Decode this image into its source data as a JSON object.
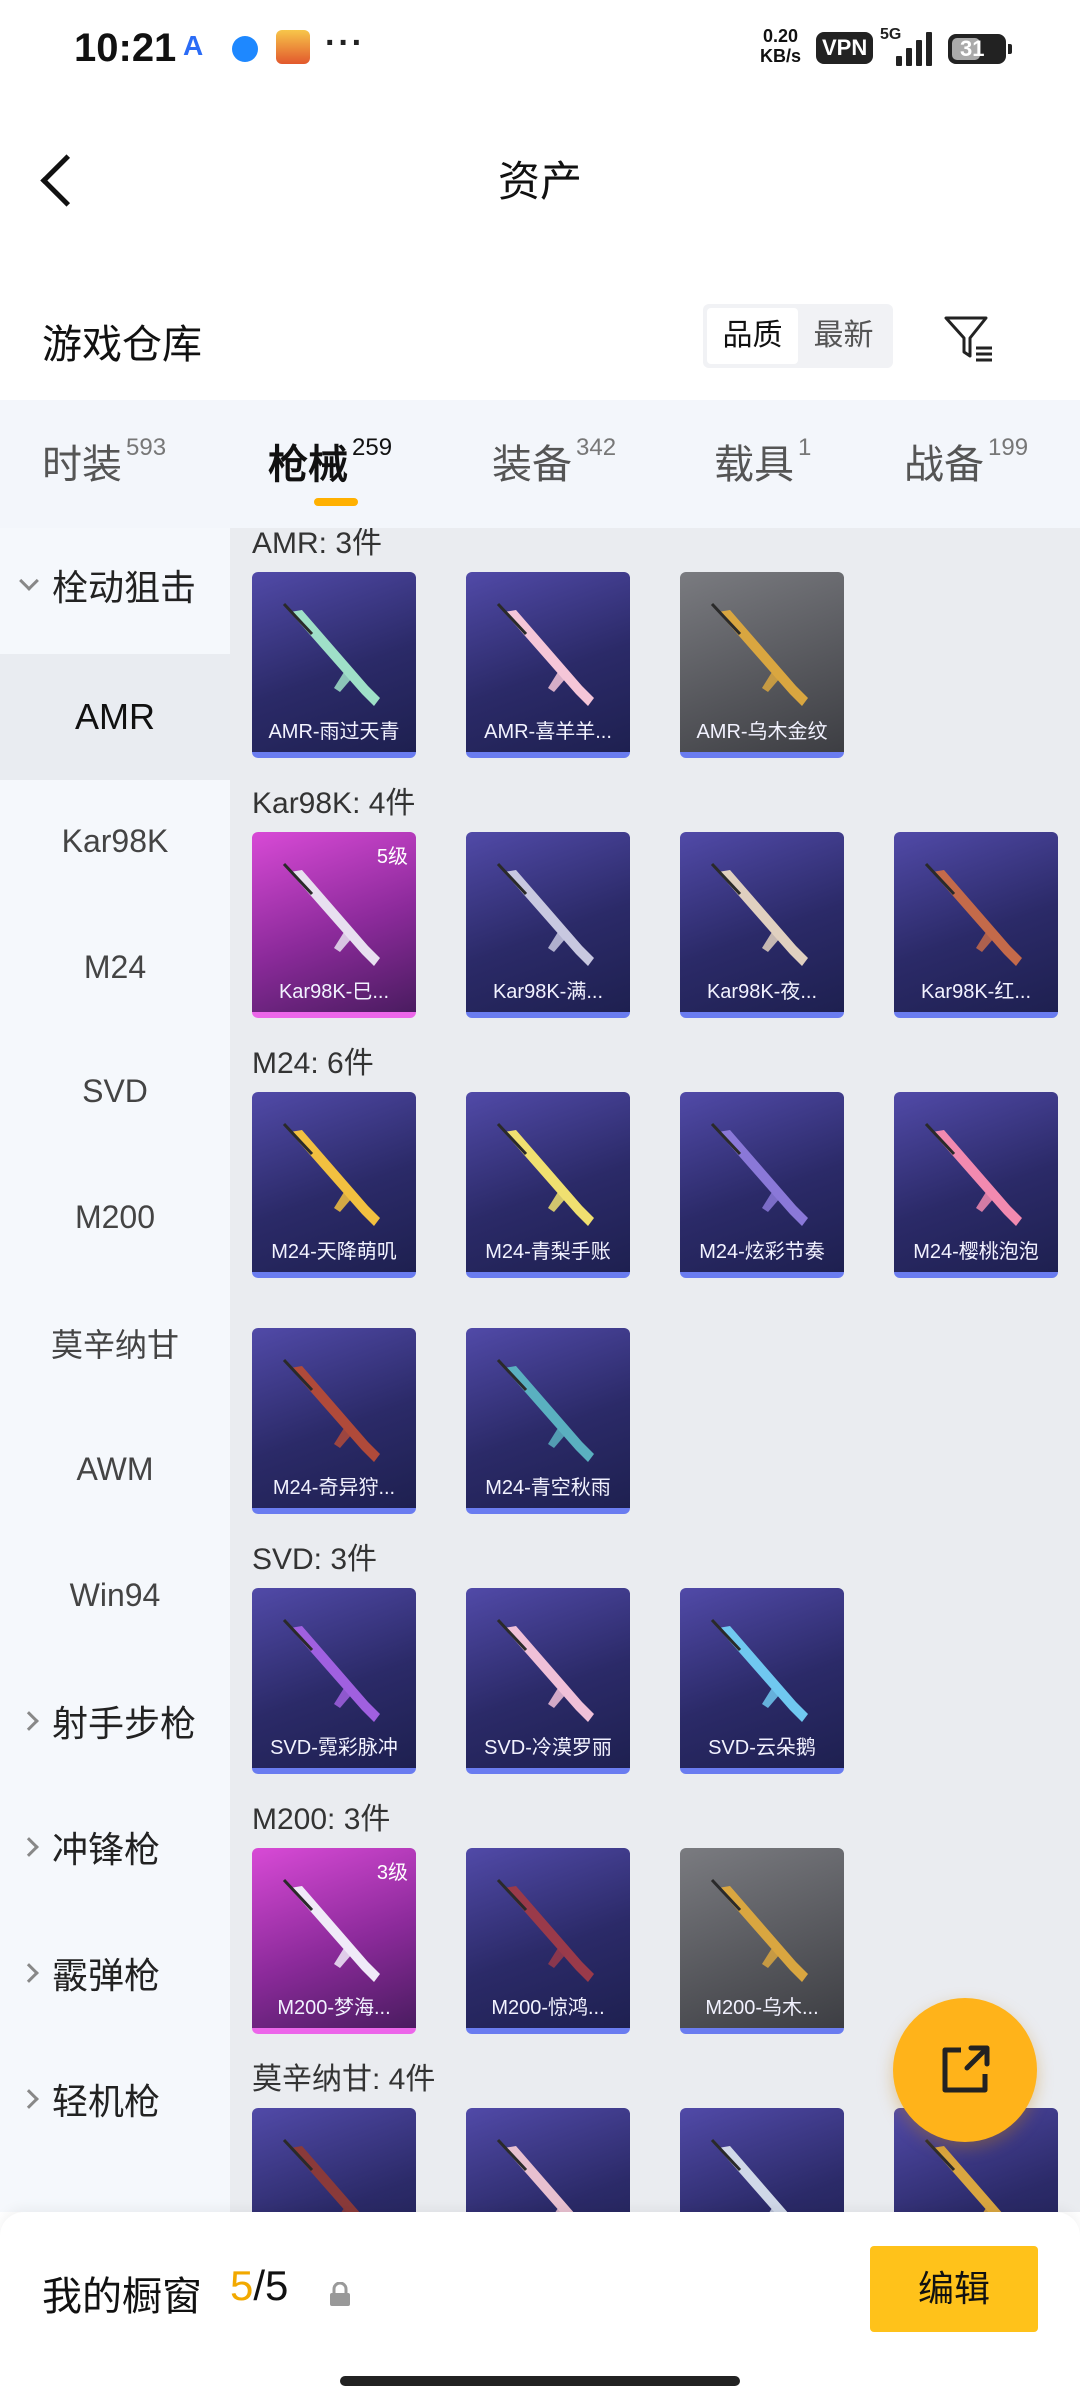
{
  "status_bar": {
    "time": "10:21",
    "net_speed_value": "0.20",
    "net_speed_unit": "KB/s",
    "vpn": "VPN",
    "network": "5G",
    "battery": "31"
  },
  "header": {
    "title": "资产"
  },
  "section": {
    "title": "游戏仓库",
    "sort_options": [
      "品质",
      "最新"
    ],
    "sort_active": "品质"
  },
  "category_tabs": [
    {
      "label": "时装",
      "count": "593"
    },
    {
      "label": "枪械",
      "count": "259",
      "active": true
    },
    {
      "label": "装备",
      "count": "342"
    },
    {
      "label": "载具",
      "count": "1"
    },
    {
      "label": "战备",
      "count": "199"
    }
  ],
  "sidebar": [
    {
      "label": "栓动狙击",
      "type": "group",
      "expanded": true
    },
    {
      "label": "AMR",
      "active": true
    },
    {
      "label": "Kar98K"
    },
    {
      "label": "M24"
    },
    {
      "label": "SVD"
    },
    {
      "label": "M200"
    },
    {
      "label": "莫辛纳甘"
    },
    {
      "label": "AWM"
    },
    {
      "label": "Win94"
    },
    {
      "label": "射手步枪",
      "type": "group"
    },
    {
      "label": "冲锋枪",
      "type": "group"
    },
    {
      "label": "霰弹枪",
      "type": "group"
    },
    {
      "label": "轻机枪",
      "type": "group"
    }
  ],
  "groups": [
    {
      "header": "AMR: 3件",
      "items": [
        {
          "name": "AMR-雨过天青",
          "style": "purple",
          "color": "#9fe0c8"
        },
        {
          "name": "AMR-喜羊羊...",
          "style": "purple",
          "color": "#f5c6d8"
        },
        {
          "name": "AMR-乌木金纹",
          "style": "grey",
          "color": "#d9a640"
        }
      ]
    },
    {
      "header": "Kar98K: 4件",
      "items": [
        {
          "name": "Kar98K-巳...",
          "style": "pink",
          "level": "5级",
          "color": "#e8e0f0"
        },
        {
          "name": "Kar98K-满...",
          "style": "purple",
          "color": "#c8c8e0"
        },
        {
          "name": "Kar98K-夜...",
          "style": "purple",
          "color": "#e0d0c0"
        },
        {
          "name": "Kar98K-红...",
          "style": "purple",
          "color": "#c46a4a"
        }
      ]
    },
    {
      "header": "M24: 6件",
      "items": [
        {
          "name": "M24-天降萌叽",
          "style": "purple",
          "color": "#f2c040"
        },
        {
          "name": "M24-青梨手账",
          "style": "purple",
          "color": "#f0e070"
        },
        {
          "name": "M24-炫彩节奏",
          "style": "purple",
          "color": "#8a78d8"
        },
        {
          "name": "M24-樱桃泡泡",
          "style": "purple",
          "color": "#f28ab0"
        },
        {
          "name": "M24-奇异狩...",
          "style": "purple",
          "color": "#b04a3a"
        },
        {
          "name": "M24-青空秋雨",
          "style": "purple",
          "color": "#5ab0c0"
        }
      ]
    },
    {
      "header": "SVD: 3件",
      "items": [
        {
          "name": "SVD-霓彩脉冲",
          "style": "purple",
          "color": "#a060e0"
        },
        {
          "name": "SVD-冷漠罗丽",
          "style": "purple",
          "color": "#f0c0d8"
        },
        {
          "name": "SVD-云朵鹅",
          "style": "purple",
          "color": "#70c8f0"
        }
      ]
    },
    {
      "header": "M200: 3件",
      "items": [
        {
          "name": "M200-梦海...",
          "style": "pink",
          "level": "3级",
          "color": "#f0eaf8"
        },
        {
          "name": "M200-惊鸿...",
          "style": "purple",
          "color": "#9a3a4a"
        },
        {
          "name": "M200-乌木...",
          "style": "grey",
          "color": "#d9a640"
        }
      ]
    },
    {
      "header": "莫辛纳甘: 4件",
      "items": [
        {
          "name": "",
          "style": "purple",
          "color": "#8a3a3a"
        },
        {
          "name": "",
          "style": "purple",
          "color": "#e8c0d0"
        },
        {
          "name": "",
          "style": "purple",
          "color": "#d0d8e8"
        },
        {
          "name": "",
          "style": "purple",
          "color": "#d9a640"
        }
      ]
    }
  ],
  "bottom_bar": {
    "label": "我的橱窗",
    "current": "5",
    "separator": "/",
    "total": "5",
    "edit_label": "编辑"
  },
  "colors": {
    "accent": "#ffb000",
    "edit_button": "#ffc21a",
    "fab": "#ffb31a"
  }
}
